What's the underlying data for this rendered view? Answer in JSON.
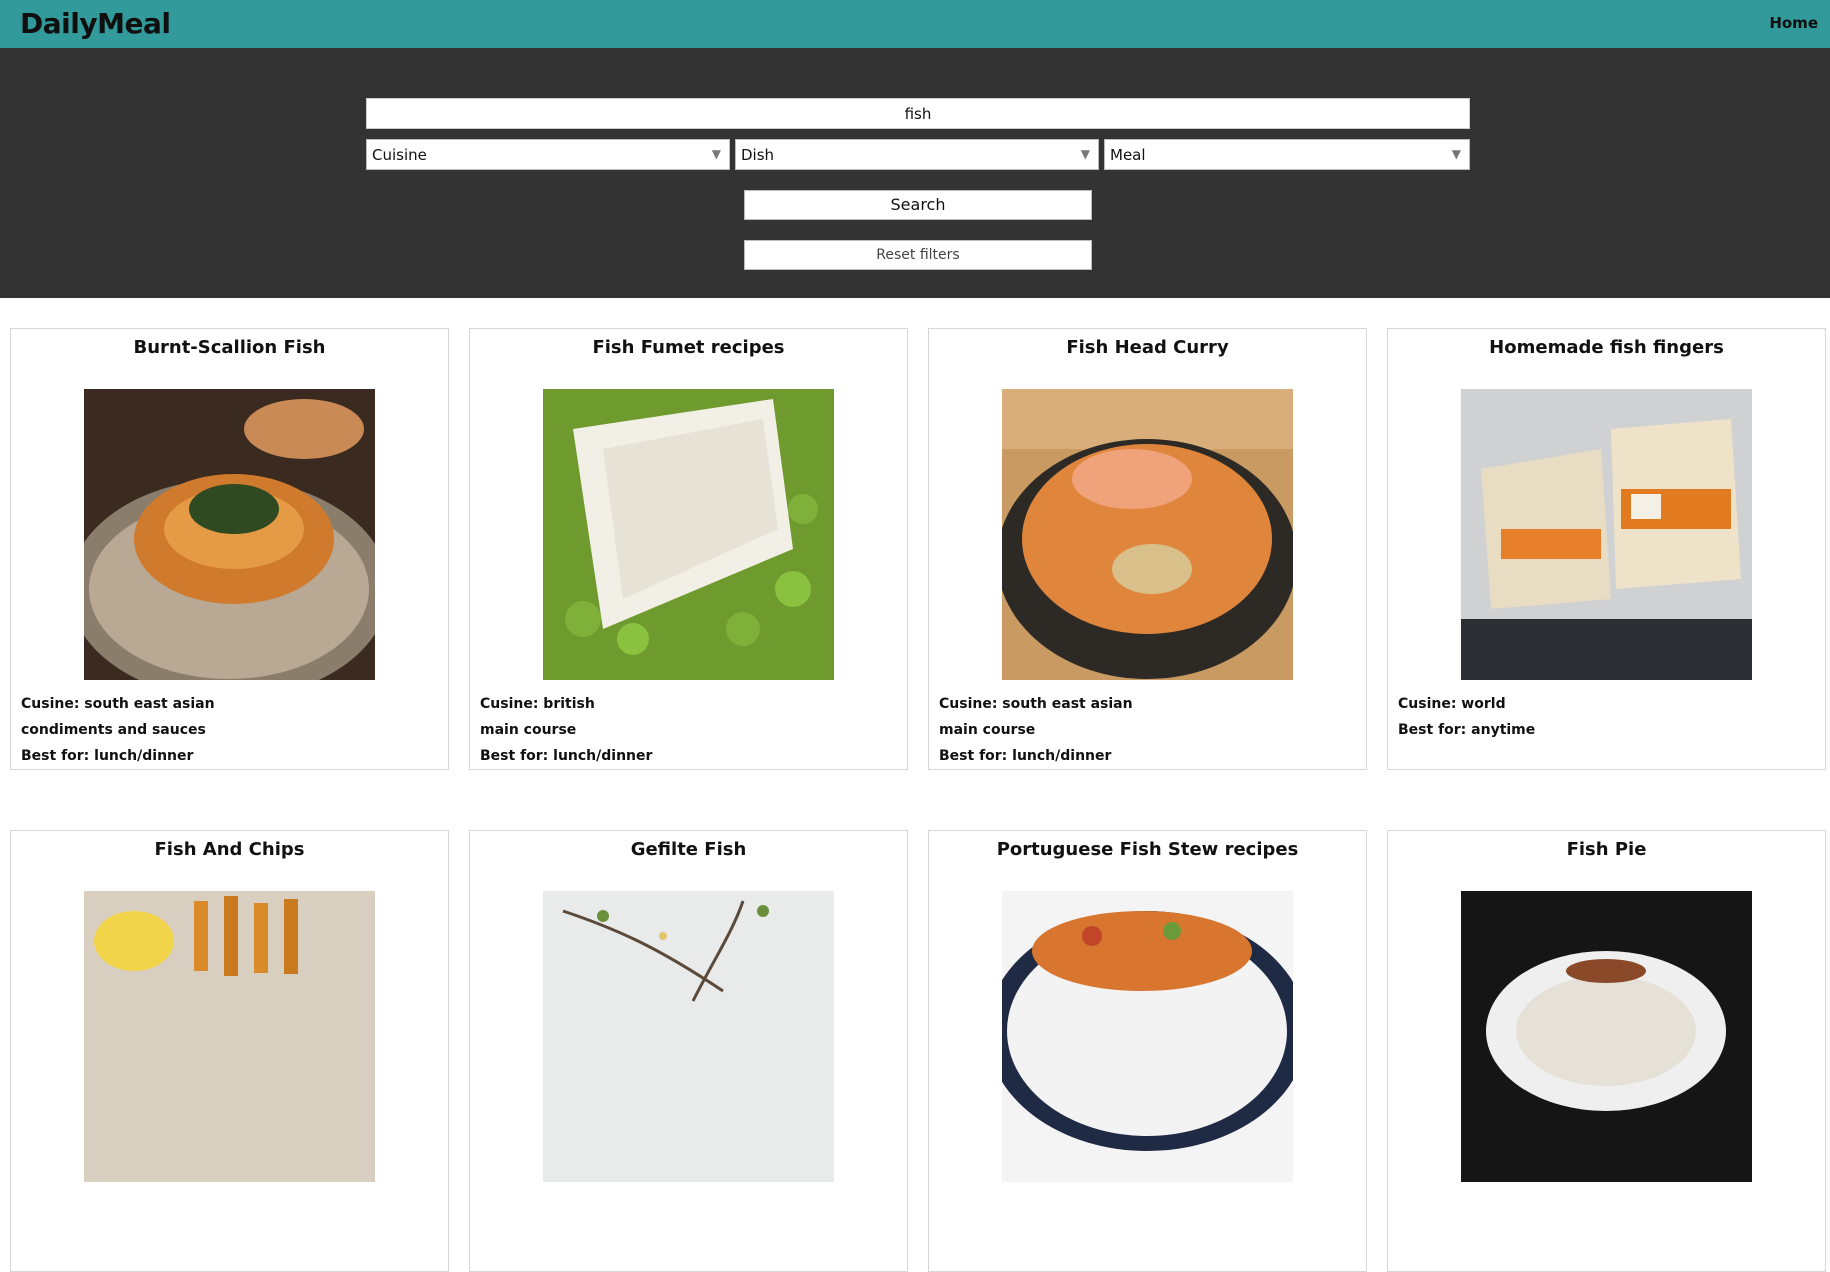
{
  "app": {
    "brand": "DailyMeal",
    "nav_home": "Home"
  },
  "search": {
    "query": "fish",
    "cuisine_label": "Cuisine",
    "dish_label": "Dish",
    "meal_label": "Meal",
    "search_button": "Search",
    "reset_button": "Reset filters"
  },
  "colors": {
    "topbar": "#329a9a",
    "searchband": "#333333"
  },
  "recipes": [
    {
      "title": "Burnt-Scallion Fish",
      "cuisine": "Cusine: south east asian",
      "dish": "condiments and sauces",
      "best_for": "Best for: lunch/dinner"
    },
    {
      "title": "Fish Fumet recipes",
      "cuisine": "Cusine: british",
      "dish": "main course",
      "best_for": "Best for: lunch/dinner"
    },
    {
      "title": "Fish Head Curry",
      "cuisine": "Cusine: south east asian",
      "dish": "main course",
      "best_for": "Best for: lunch/dinner"
    },
    {
      "title": "Homemade fish fingers",
      "cuisine": "Cusine: world",
      "dish": "",
      "best_for": "Best for: anytime"
    },
    {
      "title": "Fish And Chips"
    },
    {
      "title": "Gefilte Fish"
    },
    {
      "title": "Portuguese Fish Stew recipes"
    },
    {
      "title": "Fish Pie"
    }
  ]
}
